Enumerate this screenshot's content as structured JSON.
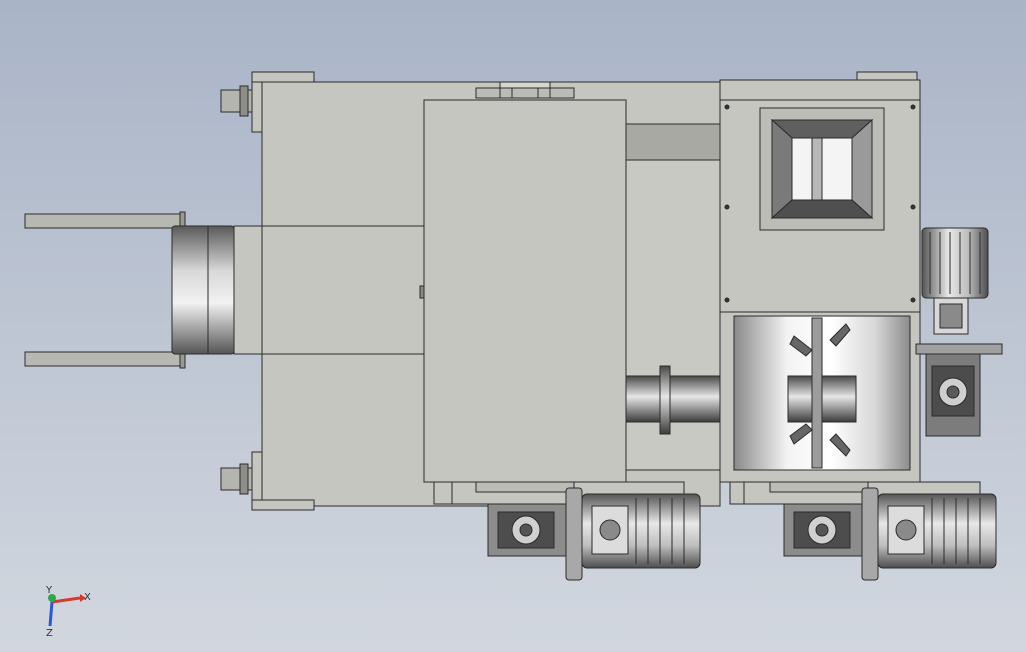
{
  "viewport": {
    "background_top": "#a9b4c7",
    "background_bottom": "#d2d7df"
  },
  "colors": {
    "body": "#c6c6c0",
    "body_dark": "#a9a9a3",
    "edge": "#2b2b2b",
    "steel_light": "#eeeeee",
    "steel_dark": "#6e6e6e",
    "hopper_inner": "#f4f4f4"
  },
  "triad": {
    "x_label": "X",
    "y_label": "Y",
    "z_label": "Z",
    "x_color": "#d63a2a",
    "y_color": "#2fa84a",
    "z_color": "#2f56d6"
  },
  "components": {
    "main_housing": "main-housing",
    "front_panel": "front-panel",
    "hopper": "inlet-hopper",
    "trough": "mixing-trough",
    "shaft": "connecting-shaft",
    "right_motor": "right-gear-motor",
    "bottom_motor_left": "bottom-gear-motor-left",
    "bottom_motor_right": "bottom-gear-motor-right",
    "drum": "drive-drum",
    "rails": "guide-rails"
  }
}
